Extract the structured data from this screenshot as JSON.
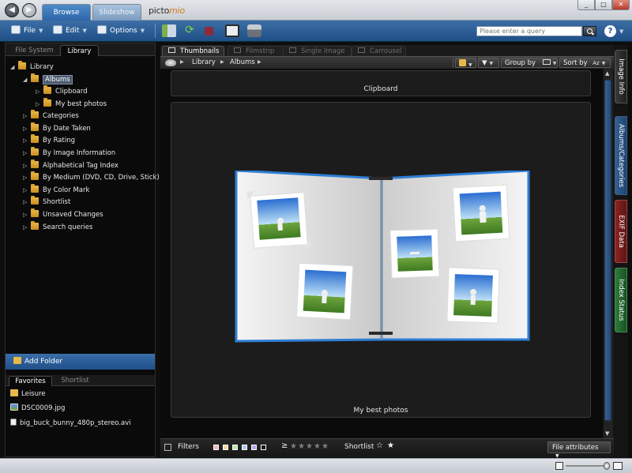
{
  "titlebar": {
    "tabs": [
      {
        "label": "Browse",
        "active": true
      },
      {
        "label": "Slideshow",
        "active": false
      }
    ],
    "logo_text": "picto",
    "logo_accent": "mio"
  },
  "toolbar": {
    "file_label": "File",
    "edit_label": "Edit",
    "options_label": "Options",
    "search_placeholder": "Please enter a query",
    "help_label": "?"
  },
  "left_panel": {
    "tabs": [
      "File System",
      "Library"
    ],
    "active_tab": "Library",
    "tree": [
      {
        "label": "Library",
        "level": 0,
        "expanded": true
      },
      {
        "label": "Albums",
        "level": 1,
        "expanded": true,
        "selected": true
      },
      {
        "label": "Clipboard",
        "level": 2
      },
      {
        "label": "My best photos",
        "level": 2
      },
      {
        "label": "Categories",
        "level": 1
      },
      {
        "label": "By Date Taken",
        "level": 1
      },
      {
        "label": "By Rating",
        "level": 1
      },
      {
        "label": "By Image Information",
        "level": 1
      },
      {
        "label": "Alphabetical Tag Index",
        "level": 1
      },
      {
        "label": "By Medium (DVD, CD, Drive, Stick)",
        "level": 1
      },
      {
        "label": "By Color Mark",
        "level": 1
      },
      {
        "label": "Shortlist",
        "level": 1
      },
      {
        "label": "Unsaved Changes",
        "level": 1
      },
      {
        "label": "Search queries",
        "level": 1
      }
    ],
    "add_folder_label": "Add Folder",
    "bottom_tabs": [
      "Favorites",
      "Shortlist"
    ],
    "favorites": [
      {
        "label": "Leisure",
        "icon": "folder-icon"
      },
      {
        "label": "DSC0009.jpg",
        "icon": "image-file-icon"
      },
      {
        "label": "big_buck_bunny_480p_stereo.avi",
        "icon": "video-file-icon"
      }
    ]
  },
  "view": {
    "tabs": [
      {
        "label": "Thumbnails",
        "active": true
      },
      {
        "label": "Filmstrip",
        "active": false
      },
      {
        "label": "Single Image",
        "active": false
      },
      {
        "label": "Carrousel",
        "active": false
      }
    ],
    "breadcrumb": [
      "Library",
      "Albums"
    ],
    "group_by_label": "Group by",
    "sort_by_label": "Sort by",
    "sort_icon_text": "Az"
  },
  "albums": [
    {
      "label": "Clipboard"
    },
    {
      "label": "My best photos"
    }
  ],
  "bottom_bar": {
    "filters_label": "Filters",
    "color_marks": [
      "#f2b8b8",
      "#f4d79a",
      "#bfe8a6",
      "#a9c8f2",
      "#b6a6ea",
      "#1a1a1a"
    ],
    "rating_prefix": "≥",
    "rating_stars": 5,
    "shortlist_label": "Shortlist",
    "file_attributes_label": "File attributes"
  },
  "side_tabs": [
    "Image Info",
    "Albums/Categories",
    "EXIF Data",
    "Index Status"
  ],
  "colors": {
    "accent_blue": "#2c66a8",
    "exif_red": "#8a2424",
    "index_green": "#2f7a3c",
    "album_edge": "#2f7fd6"
  }
}
